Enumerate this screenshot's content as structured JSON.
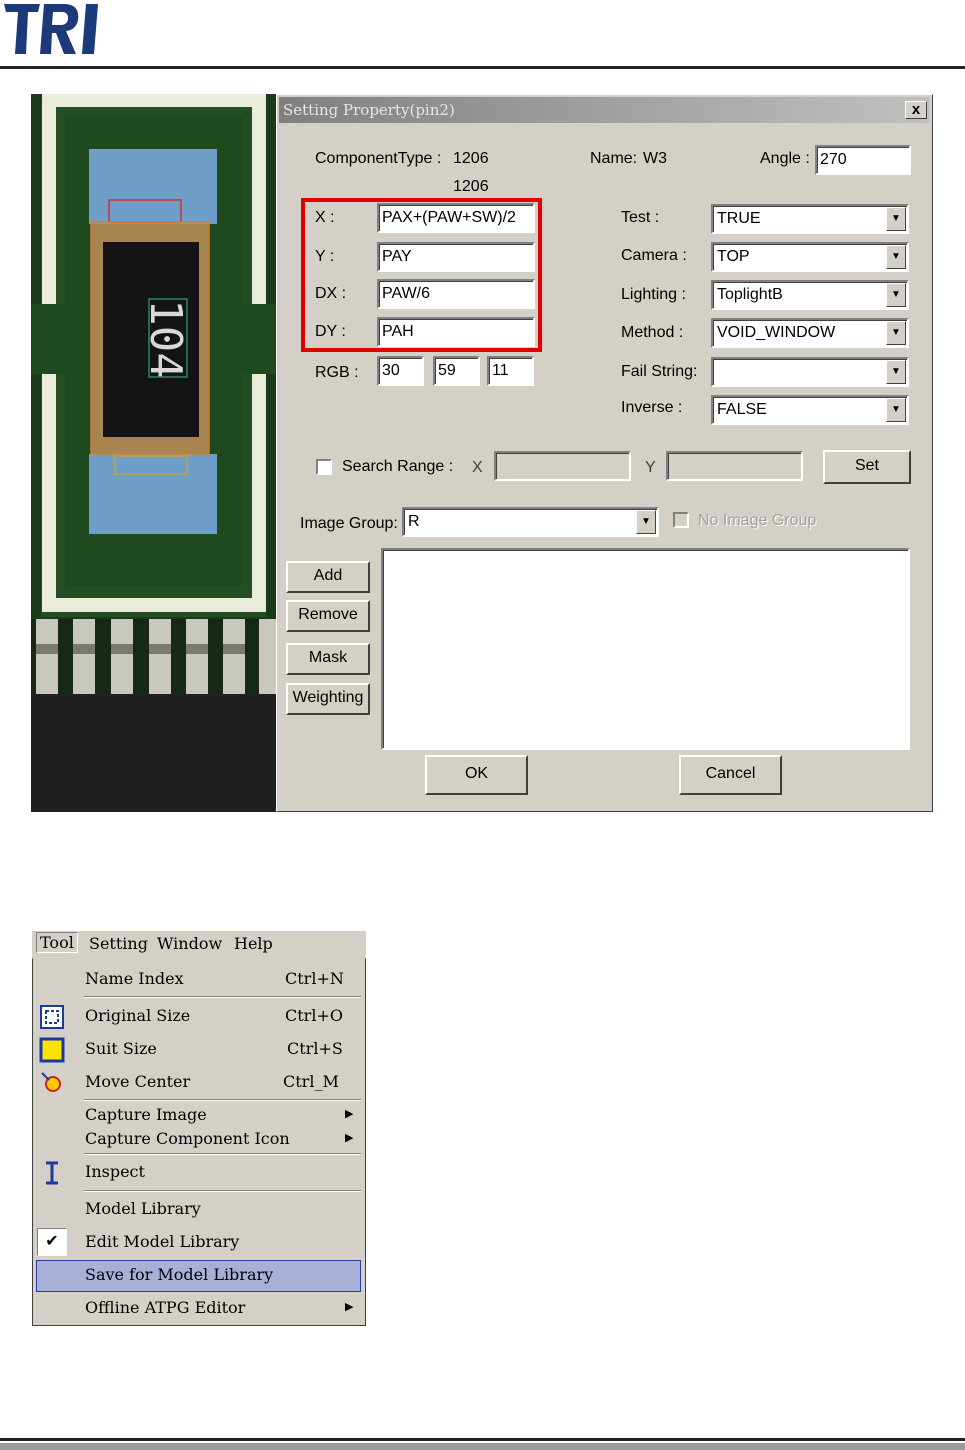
{
  "header": {
    "logo_text": "TRI"
  },
  "dialog": {
    "title": "Setting Property(pin2)",
    "close_label": "x",
    "component_type_label": "ComponentType :",
    "component_type_value": "1206",
    "component_type_value2": "1206",
    "name_label": "Name:",
    "name_value": "W3",
    "angle_label": "Angle :",
    "angle_value": "270",
    "x_label": "X :",
    "x_value": "PAX+(PAW+SW)/2",
    "y_label": "Y :",
    "y_value": "PAY",
    "dx_label": "DX :",
    "dx_value": "PAW/6",
    "dy_label": "DY :",
    "dy_value": "PAH",
    "rgb_label": "RGB :",
    "rgb_values": [
      "30",
      "59",
      "11"
    ],
    "test_label": "Test :",
    "test_value": "TRUE",
    "camera_label": "Camera :",
    "camera_value": "TOP",
    "lighting_label": "Lighting :",
    "lighting_value": "ToplightB",
    "method_label": "Method :",
    "method_value": "VOID_WINDOW",
    "fail_string_label": "Fail String:",
    "fail_string_value": "",
    "inverse_label": "Inverse :",
    "inverse_value": "FALSE",
    "search_range_label": "Search Range :",
    "search_x_label": "X",
    "search_y_label": "Y",
    "set_label": "Set",
    "image_group_label": "Image Group:",
    "image_group_value": "R",
    "no_image_group_label": "No Image Group",
    "add_label": "Add",
    "remove_label": "Remove",
    "mask_label": "Mask",
    "weighting_label": "Weighting",
    "ok_label": "OK",
    "cancel_label": "Cancel"
  },
  "pcb": {
    "marking": "104"
  },
  "menu": {
    "bar": [
      "Tool",
      "Setting",
      "Window",
      "Help"
    ],
    "items": [
      {
        "label": "Name Index",
        "shortcut": "Ctrl+N"
      },
      {
        "label": "Original Size",
        "shortcut": "Ctrl+O"
      },
      {
        "label": "Suit Size",
        "shortcut": "Ctrl+S"
      },
      {
        "label": "Move Center",
        "shortcut": "Ctrl_M"
      },
      {
        "label": "Capture Image",
        "shortcut": ""
      },
      {
        "label": "Capture Component Icon",
        "shortcut": ""
      },
      {
        "label": "Inspect",
        "shortcut": ""
      },
      {
        "label": "Model Library",
        "shortcut": ""
      },
      {
        "label": "Edit Model Library",
        "shortcut": ""
      },
      {
        "label": "Save for Model Library",
        "shortcut": ""
      },
      {
        "label": "Offline ATPG Editor",
        "shortcut": ""
      }
    ]
  },
  "colors": {
    "dialog_bg": "#d4d0c8",
    "highlight": "#e00000",
    "menu_highlight": "#a8b0d8",
    "pcb_green": "#1e4a1e"
  }
}
